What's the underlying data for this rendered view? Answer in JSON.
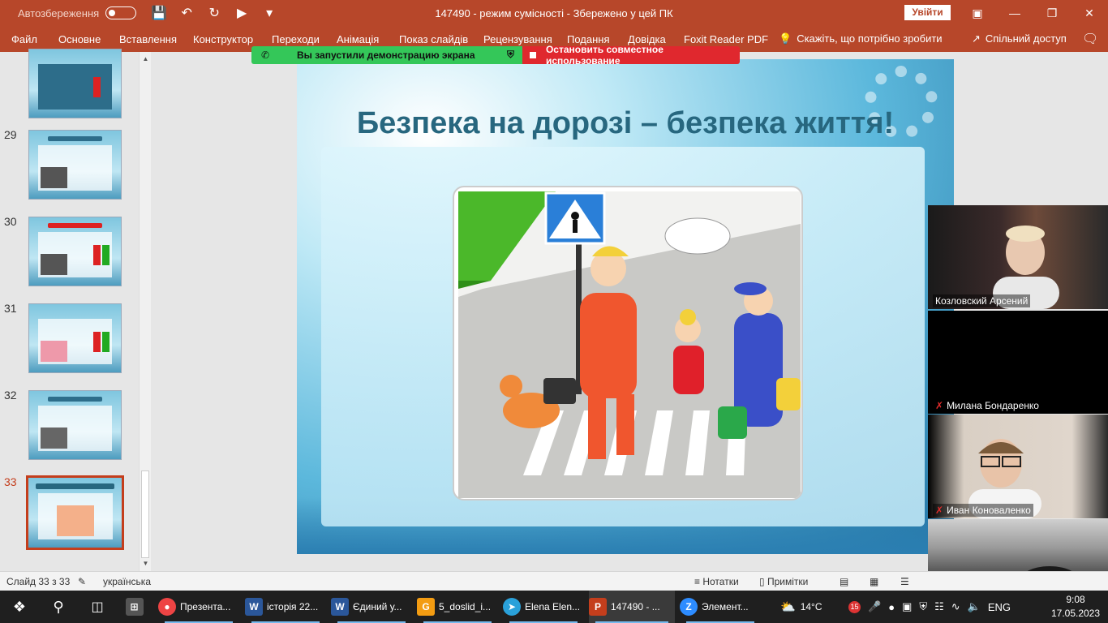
{
  "titlebar": {
    "autosave_label": "Автозбереження",
    "doc_title": "147490  -  режим сумісності  -  Збережено у цей ПК",
    "signin_label": "Увійти"
  },
  "ribbon": {
    "tabs": [
      "Файл",
      "Основне",
      "Вставлення",
      "Конструктор",
      "Переходи",
      "Анімація",
      "Показ слайдів",
      "Рецензування",
      "Подання",
      "Довідка",
      "Foxit Reader PDF"
    ],
    "tell_me": "Скажіть, що потрібно зробити",
    "share": "Спільний доступ"
  },
  "share_banner": {
    "status": "Вы запустили демонстрацию экрана",
    "stop": "Остановить совместное использование"
  },
  "thumbnails": {
    "numbers": [
      "29",
      "30",
      "31",
      "32",
      "33"
    ],
    "active": "33"
  },
  "slide": {
    "title": "Безпека на дорозі – безпека життя!"
  },
  "participants": [
    "Козловский Арсений",
    "Милана Бондаренко",
    "Иван Коноваленко"
  ],
  "statusbar": {
    "slide_info": "Слайд 33 з 33",
    "language": "українська",
    "notes": "Нотатки",
    "comments": "Примітки"
  },
  "taskbar": {
    "apps": [
      "Презента...",
      "історія 22...",
      "Єдиний у...",
      "5_doslid_i...",
      "Elena Elen...",
      "147490  - ...",
      "Элемент..."
    ],
    "weather": "14°C",
    "lang": "ENG",
    "time": "9:08",
    "date": "17.05.2023",
    "badge": "15"
  },
  "colors": {
    "accent": "#b7472a",
    "banner_green": "#34c759",
    "banner_red": "#e0282e",
    "active_thumb": "#c43e1c"
  }
}
